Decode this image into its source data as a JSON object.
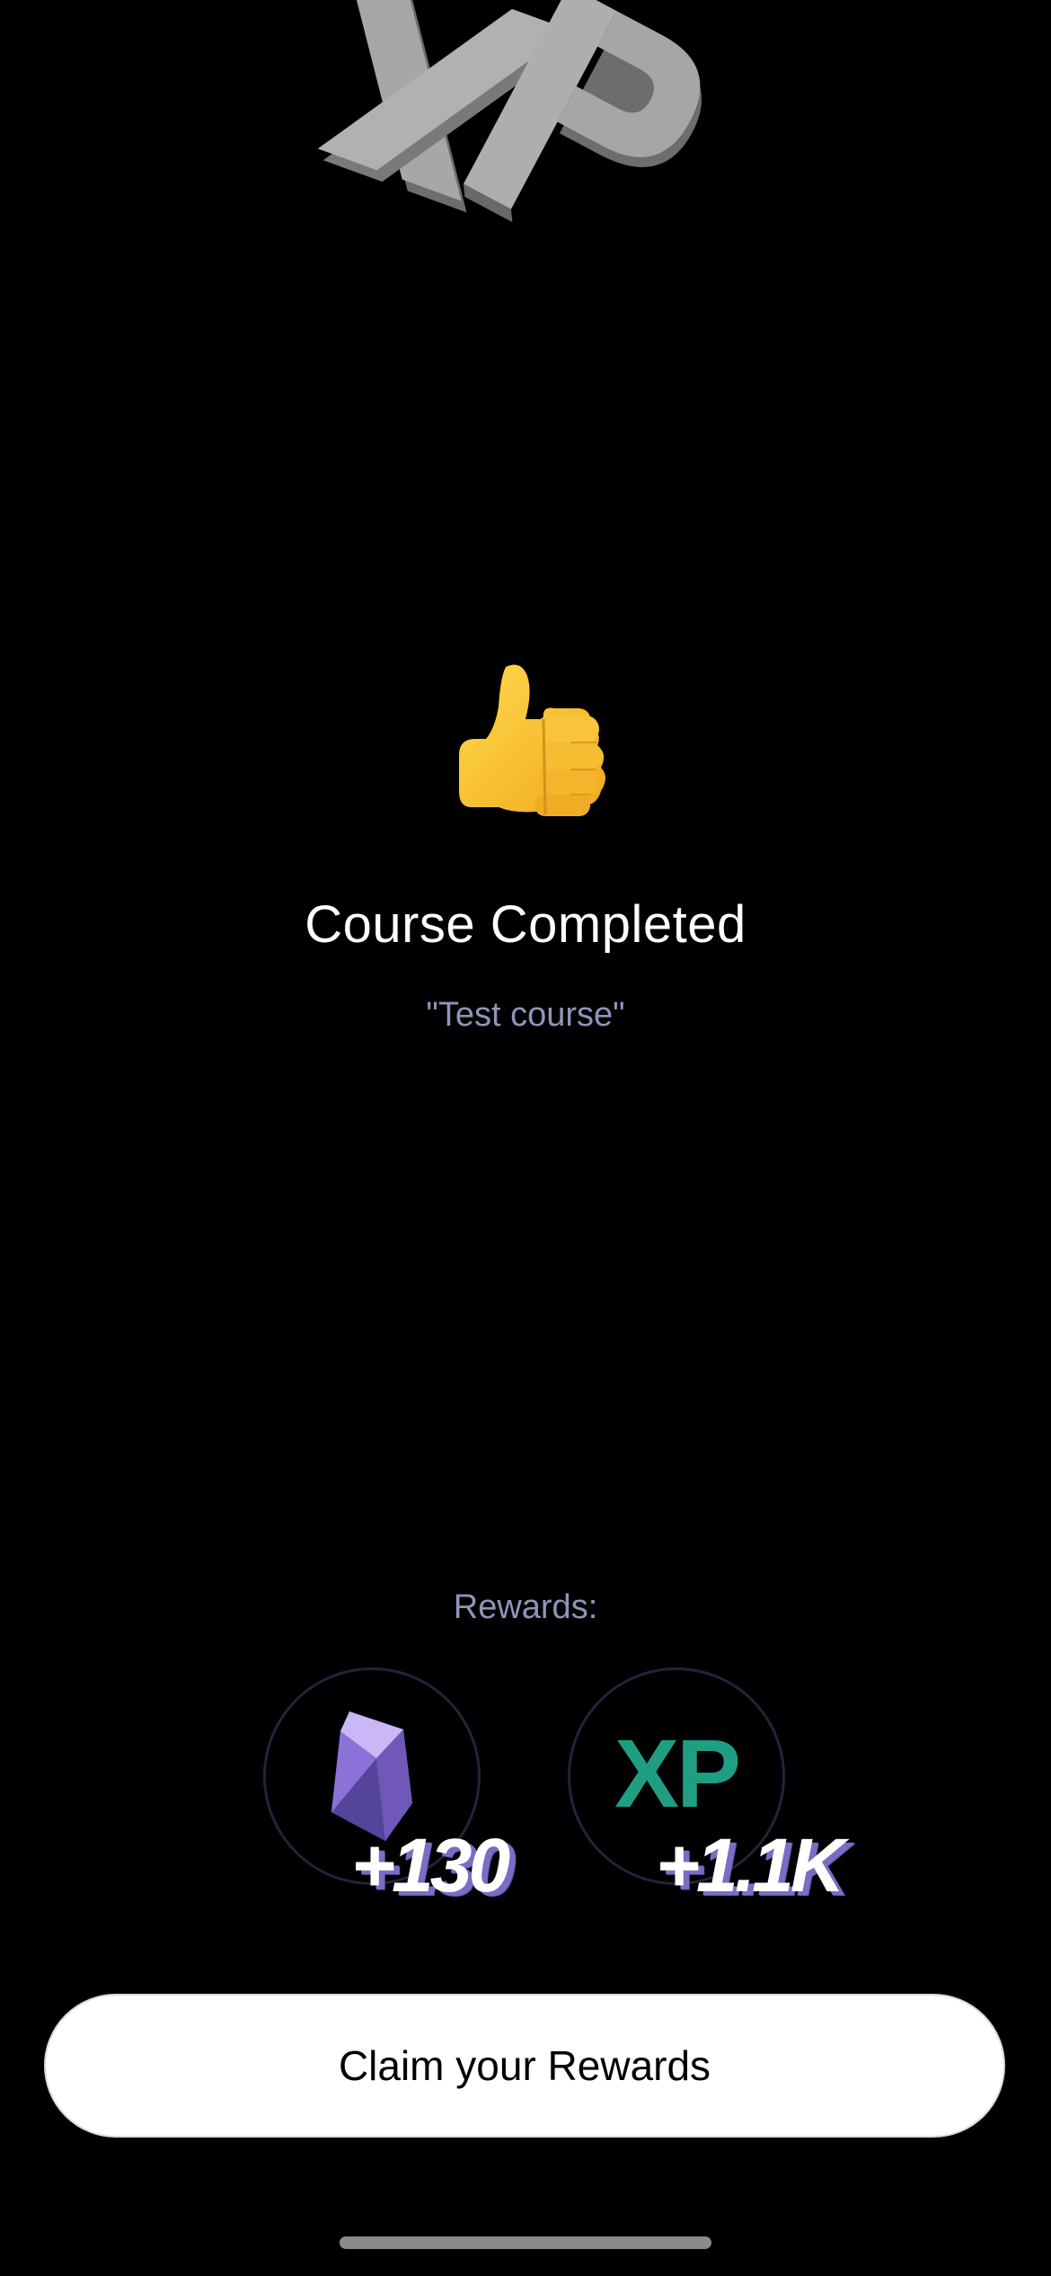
{
  "decoration": {
    "top_letters": "XP"
  },
  "completion": {
    "emoji_icon": "thumbs-up-icon",
    "title": "Course Completed",
    "course_name": "\"Test course\""
  },
  "rewards": {
    "label": "Rewards:",
    "items": [
      {
        "icon": "gem-icon",
        "amount": "+130"
      },
      {
        "icon": "xp-icon",
        "icon_text": "XP",
        "amount": "+1.1K"
      }
    ]
  },
  "actions": {
    "claim_label": "Claim your Rewards"
  },
  "colors": {
    "background": "#000000",
    "muted_text": "#8f95b8",
    "xp_green": "#1f9e83",
    "gem_purple": "#9a83e0",
    "amount_shadow": "#7d6bc5"
  }
}
